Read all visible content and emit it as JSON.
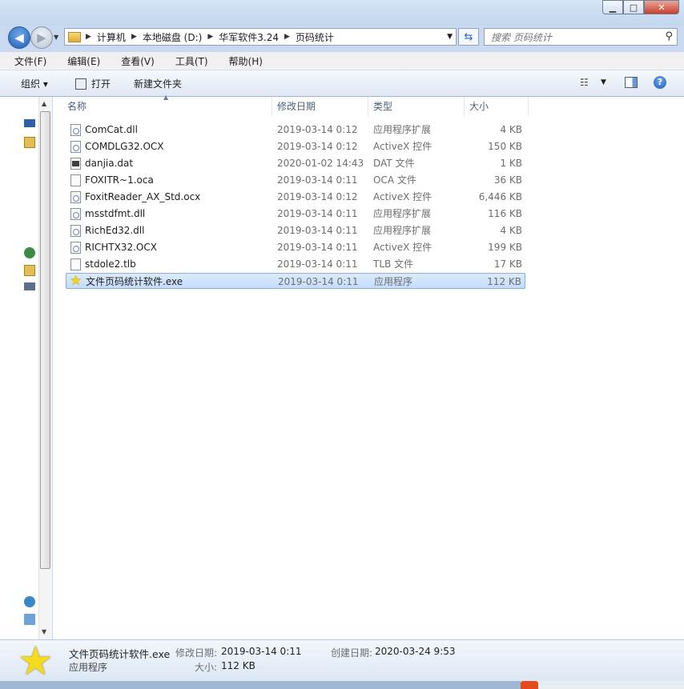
{
  "window": {
    "title_ghost": "",
    "center_ghost": ""
  },
  "titlebar": {
    "min_icon": "minimize-icon",
    "max_icon": "maximize-icon",
    "close_icon": "close-icon"
  },
  "address": {
    "crumbs": [
      "计算机",
      "本地磁盘 (D:)",
      "华军软件3.24",
      "页码统计"
    ]
  },
  "search": {
    "placeholder": "搜索 页码统计"
  },
  "menu": [
    "文件(F)",
    "编辑(E)",
    "查看(V)",
    "工具(T)",
    "帮助(H)"
  ],
  "toolbar": {
    "organize": "组织 ▾",
    "open": "打开",
    "new_folder": "新建文件夹"
  },
  "columns": {
    "name": "名称",
    "date": "修改日期",
    "type": "类型",
    "size": "大小"
  },
  "files": [
    {
      "name": "ComCat.dll",
      "date": "2019-03-14 0:12",
      "type": "应用程序扩展",
      "size": "4 KB",
      "icon": "dll"
    },
    {
      "name": "COMDLG32.OCX",
      "date": "2019-03-14 0:12",
      "type": "ActiveX 控件",
      "size": "150 KB",
      "icon": "dll"
    },
    {
      "name": "danjia.dat",
      "date": "2020-01-02 14:43",
      "type": "DAT 文件",
      "size": "1 KB",
      "icon": "dat"
    },
    {
      "name": "FOXITR~1.oca",
      "date": "2019-03-14 0:11",
      "type": "OCA 文件",
      "size": "36 KB",
      "icon": "blank"
    },
    {
      "name": "FoxitReader_AX_Std.ocx",
      "date": "2019-03-14 0:12",
      "type": "ActiveX 控件",
      "size": "6,446 KB",
      "icon": "dll"
    },
    {
      "name": "msstdfmt.dll",
      "date": "2019-03-14 0:11",
      "type": "应用程序扩展",
      "size": "116 KB",
      "icon": "dll"
    },
    {
      "name": "RichEd32.dll",
      "date": "2019-03-14 0:11",
      "type": "应用程序扩展",
      "size": "4 KB",
      "icon": "dll"
    },
    {
      "name": "RICHTX32.OCX",
      "date": "2019-03-14 0:11",
      "type": "ActiveX 控件",
      "size": "199 KB",
      "icon": "dll"
    },
    {
      "name": "stdole2.tlb",
      "date": "2019-03-14 0:11",
      "type": "TLB 文件",
      "size": "17 KB",
      "icon": "blank"
    },
    {
      "name": "文件页码统计软件.exe",
      "date": "2019-03-14 0:11",
      "type": "应用程序",
      "size": "112 KB",
      "icon": "star",
      "selected": true
    }
  ],
  "details": {
    "name": "文件页码统计软件.exe",
    "type": "应用程序",
    "modified_label": "修改日期:",
    "modified_value": "2019-03-14 0:11",
    "created_label": "创建日期:",
    "created_value": "2020-03-24 9:53",
    "size_label": "大小:",
    "size_value": "112 KB"
  }
}
